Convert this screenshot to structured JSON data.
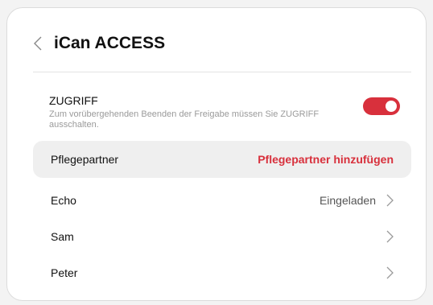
{
  "header": {
    "title": "iCan ACCESS"
  },
  "access": {
    "title": "ZUGRIFF",
    "note": "Zum vorübergehenden Beenden der Freigabe müssen Sie ZUGRIFF ausschalten.",
    "enabled": true
  },
  "rows": [
    {
      "label": "Pflegepartner",
      "action": "Pflegepartner hinzufügen"
    },
    {
      "label": "Echo",
      "value": "Eingeladen"
    },
    {
      "label": "Sam",
      "value": ""
    },
    {
      "label": "Peter",
      "value": ""
    }
  ],
  "colors": {
    "accent": "#d8303c",
    "chevron": "#9a9a9a"
  }
}
